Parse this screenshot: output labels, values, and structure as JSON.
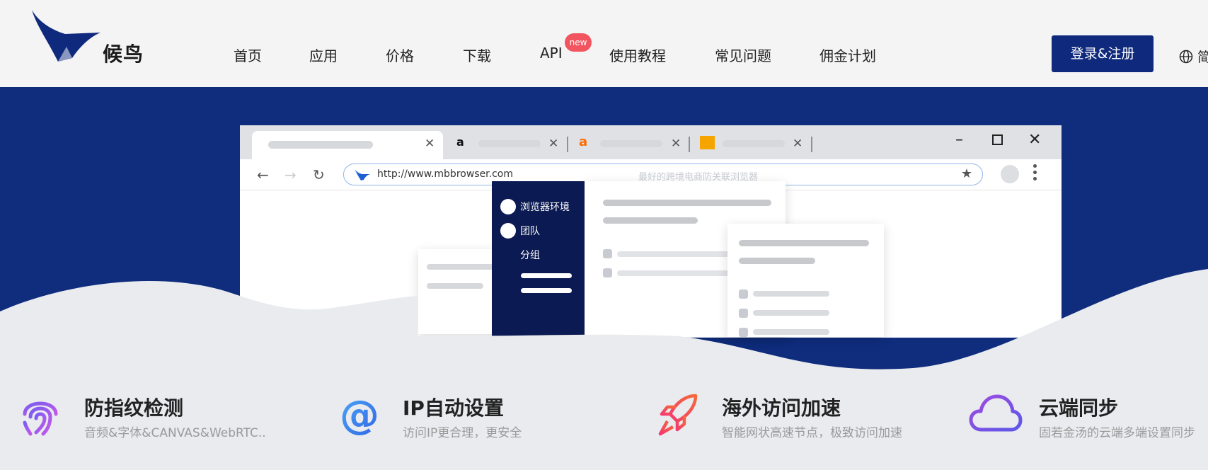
{
  "brand": {
    "name": "候鸟",
    "logo_color": "#0f2a7c"
  },
  "nav": {
    "items": [
      "首页",
      "应用",
      "价格",
      "下载",
      "API",
      "使用教程",
      "常见问题",
      "佣金计划"
    ],
    "api_badge": "new"
  },
  "header": {
    "login_label": "登录&注册",
    "lang_label": "简",
    "lang_icon": "globe-icon"
  },
  "mock_browser": {
    "url": "http://www.mbbrowser.com",
    "url_hint": "最好的跨境电商防关联浏览器",
    "tab_favicons": [
      "amazon-icon",
      "alibaba-icon",
      "logo-icon"
    ],
    "sidebar": [
      "浏览器环境",
      "团队",
      "分组"
    ]
  },
  "features": [
    {
      "icon": "fingerprint-icon",
      "title": "防指纹检测",
      "desc": "音频&字体&CANVAS&WebRTC.."
    },
    {
      "icon": "at-icon",
      "title": "IP自动设置",
      "desc": "访问IP更合理，更安全"
    },
    {
      "icon": "rocket-icon",
      "title": "海外访问加速",
      "desc": "智能网状高速节点，极致访问加速"
    },
    {
      "icon": "cloud-icon",
      "title": "云端同步",
      "desc": "固若金汤的云端多端设置同步"
    }
  ],
  "colors": {
    "hero_bg": "#0f2c7d",
    "badge": "#f25560",
    "button": "#0f2a7c"
  }
}
